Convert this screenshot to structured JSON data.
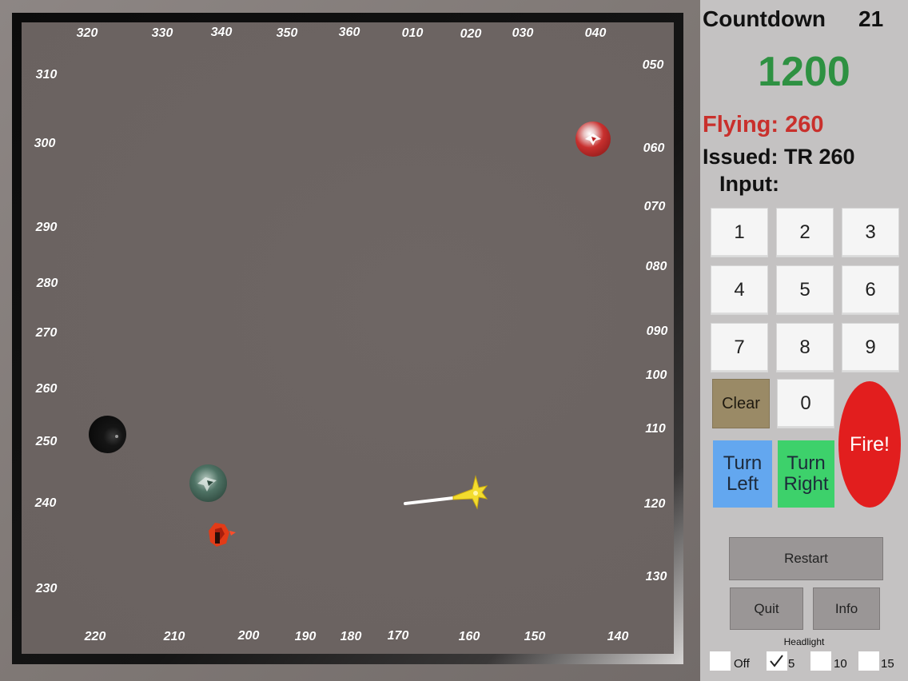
{
  "radar": {
    "headings": {
      "top": [
        "320",
        "330",
        "340",
        "350",
        "360",
        "010",
        "020",
        "030",
        "040"
      ],
      "left": [
        "310",
        "300",
        "290",
        "280",
        "270",
        "260",
        "250",
        "240",
        "230"
      ],
      "right": [
        "050",
        "060",
        "070",
        "080",
        "090",
        "100",
        "110",
        "120",
        "130"
      ],
      "bottom": [
        "220",
        "210",
        "200",
        "190",
        "180",
        "170",
        "160",
        "150",
        "140"
      ]
    }
  },
  "panel": {
    "countdown_label": "Countdown",
    "countdown_value": "21",
    "score": "1200",
    "flying": "Flying: 260",
    "issued": "Issued: TR 260",
    "input_label": "Input:",
    "keys": [
      "1",
      "2",
      "3",
      "4",
      "5",
      "6",
      "7",
      "8",
      "9"
    ],
    "clear": "Clear",
    "zero": "0",
    "fire": "Fire!",
    "turn_left_1": "Turn",
    "turn_left_2": "Left",
    "turn_right_1": "Turn",
    "turn_right_2": "Right",
    "restart": "Restart",
    "quit": "Quit",
    "info": "Info",
    "headlight_label": "Headlight",
    "headlight_options": [
      "Off",
      "5",
      "10",
      "15"
    ],
    "headlight_selected": "5"
  },
  "colors": {
    "score": "#2e9142",
    "flying": "#c9302c",
    "turn_left": "#63a7ef",
    "turn_right": "#3dd16b",
    "fire": "#e21e1e",
    "clear": "#9a8a66"
  }
}
